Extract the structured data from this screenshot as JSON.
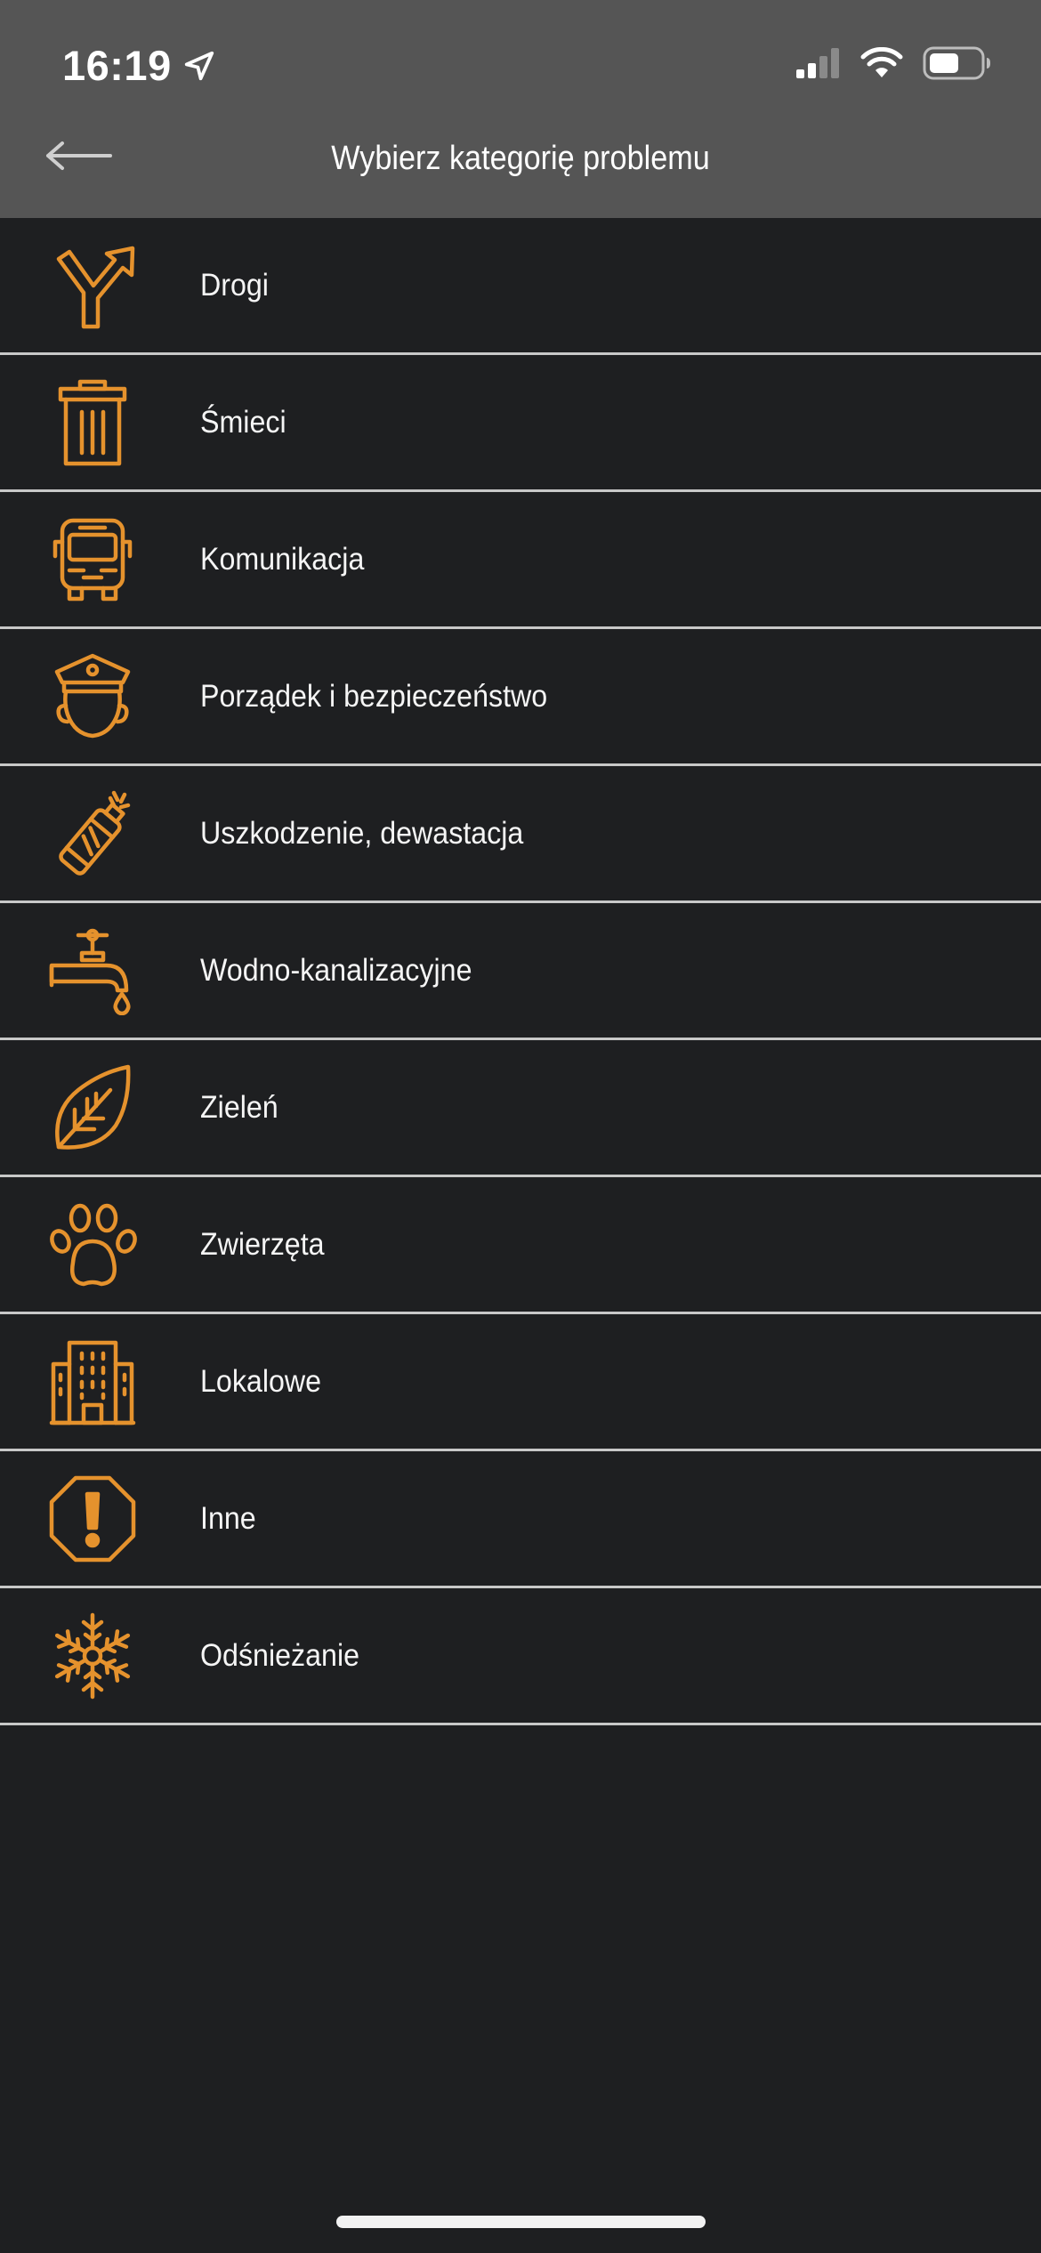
{
  "status_bar": {
    "time": "16:19",
    "icons": [
      "location-arrow-icon",
      "signal-icon",
      "wifi-icon",
      "battery-icon"
    ]
  },
  "nav": {
    "back_icon": "back-arrow-icon",
    "title": "Wybierz kategorię problemu"
  },
  "accent_color": "#e5922d",
  "categories": [
    {
      "label": "Drogi",
      "icon": "road-fork-icon"
    },
    {
      "label": "Śmieci",
      "icon": "trash-bin-icon"
    },
    {
      "label": "Komunikacja",
      "icon": "bus-icon"
    },
    {
      "label": "Porządek i bezpieczeństwo",
      "icon": "police-officer-icon"
    },
    {
      "label": "Uszkodzenie, dewastacja",
      "icon": "spray-can-icon"
    },
    {
      "label": "Wodno-kanalizacyjne",
      "icon": "water-tap-icon"
    },
    {
      "label": "Zieleń",
      "icon": "leaf-icon"
    },
    {
      "label": "Zwierzęta",
      "icon": "paw-icon"
    },
    {
      "label": "Lokalowe",
      "icon": "building-icon"
    },
    {
      "label": "Inne",
      "icon": "warning-octagon-icon"
    },
    {
      "label": "Odśnieżanie",
      "icon": "snowflake-icon"
    }
  ]
}
